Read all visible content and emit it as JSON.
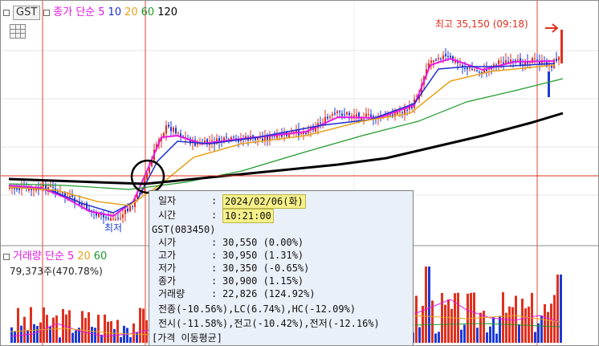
{
  "price_legend": {
    "stock": "GST",
    "label": "종가 단순",
    "ma": [
      "5",
      "10",
      "20",
      "60",
      "120"
    ]
  },
  "volume_legend": {
    "label": "거래량 단순",
    "ma": [
      "5",
      "20",
      "60"
    ],
    "info": "79,373주(470.78%)"
  },
  "high_label": "최고 35,150 (09:18)",
  "low_label": "최저",
  "colors": {
    "ma5": "#e619e6",
    "ma10": "#1e2fd0",
    "ma20": "#e8a21a",
    "ma60": "#1f9a2c",
    "ma120": "#000000",
    "up": "#e0301e",
    "down": "#1b3bd8",
    "tooltip_bg": "#eaf0f8"
  },
  "tooltip": {
    "date_label": "일자",
    "date_value": "2024/02/06(화)",
    "time_label": "시간",
    "time_value": "10:21:00",
    "code": "GST(083450)",
    "open_label": "시가",
    "open_value": "30,550 (0.00%)",
    "high_label": "고가",
    "high_value": "30,950 (1.31%)",
    "low_label": "저가",
    "low_value": "30,350 (-0.65%)",
    "close_label": "종가",
    "close_value": "30,900 (1.15%)",
    "volume_label": "거래량",
    "volume_value": "22,826 (124.92%)",
    "line1": "전종(-10.56%),LC(6.74%),HC(-12.09%)",
    "line2": "전시(-11.58%),전고(-10.42%),전저(-12.16%)",
    "line3": "[가격 이동평균]"
  },
  "icons": {
    "grid": "grid-icon",
    "high_arrow": "arrow-right-icon",
    "low_arrow": "arrow-left-icon",
    "highlight": "circle-marker-icon"
  }
}
